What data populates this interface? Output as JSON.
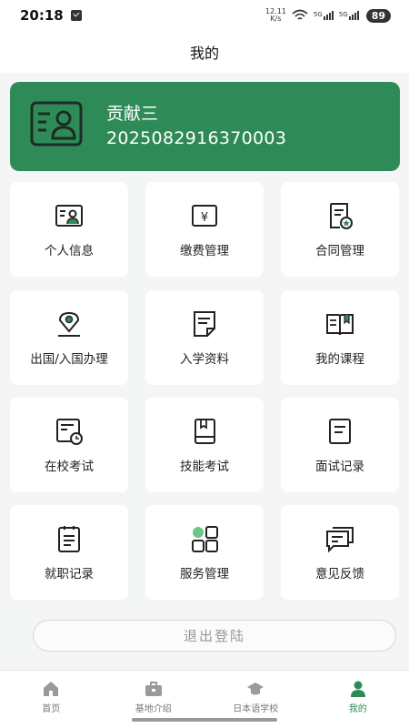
{
  "status_bar": {
    "time": "20:18",
    "speed_value": "12.11",
    "speed_unit": "K/s",
    "sig1": "5G",
    "sig2": "5G",
    "battery": "89"
  },
  "header": {
    "title": "我的"
  },
  "profile": {
    "name": "贡献三",
    "id": "2025082916370003",
    "accent_color": "#2e8b57"
  },
  "menu": [
    {
      "label": "个人信息",
      "icon": "personal-info-icon"
    },
    {
      "label": "缴费管理",
      "icon": "yen-payment-icon"
    },
    {
      "label": "合同管理",
      "icon": "contract-icon"
    },
    {
      "label": "出国/入国办理",
      "icon": "location-pin-icon"
    },
    {
      "label": "入学资料",
      "icon": "document-icon"
    },
    {
      "label": "我的课程",
      "icon": "book-icon"
    },
    {
      "label": "在校考试",
      "icon": "exam-clock-icon"
    },
    {
      "label": "技能考试",
      "icon": "skill-book-icon"
    },
    {
      "label": "面试记录",
      "icon": "interview-record-icon"
    },
    {
      "label": "就职记录",
      "icon": "clipboard-icon"
    },
    {
      "label": "服务管理",
      "icon": "grid-apps-icon"
    },
    {
      "label": "意见反馈",
      "icon": "feedback-chat-icon"
    }
  ],
  "logout": {
    "label": "退出登陆"
  },
  "tabs": [
    {
      "label": "首页",
      "icon": "home-icon",
      "active": false
    },
    {
      "label": "基地介绍",
      "icon": "briefcase-icon",
      "active": false
    },
    {
      "label": "日本语学校",
      "icon": "graduation-cap-icon",
      "active": false
    },
    {
      "label": "我的",
      "icon": "user-icon",
      "active": true
    }
  ]
}
